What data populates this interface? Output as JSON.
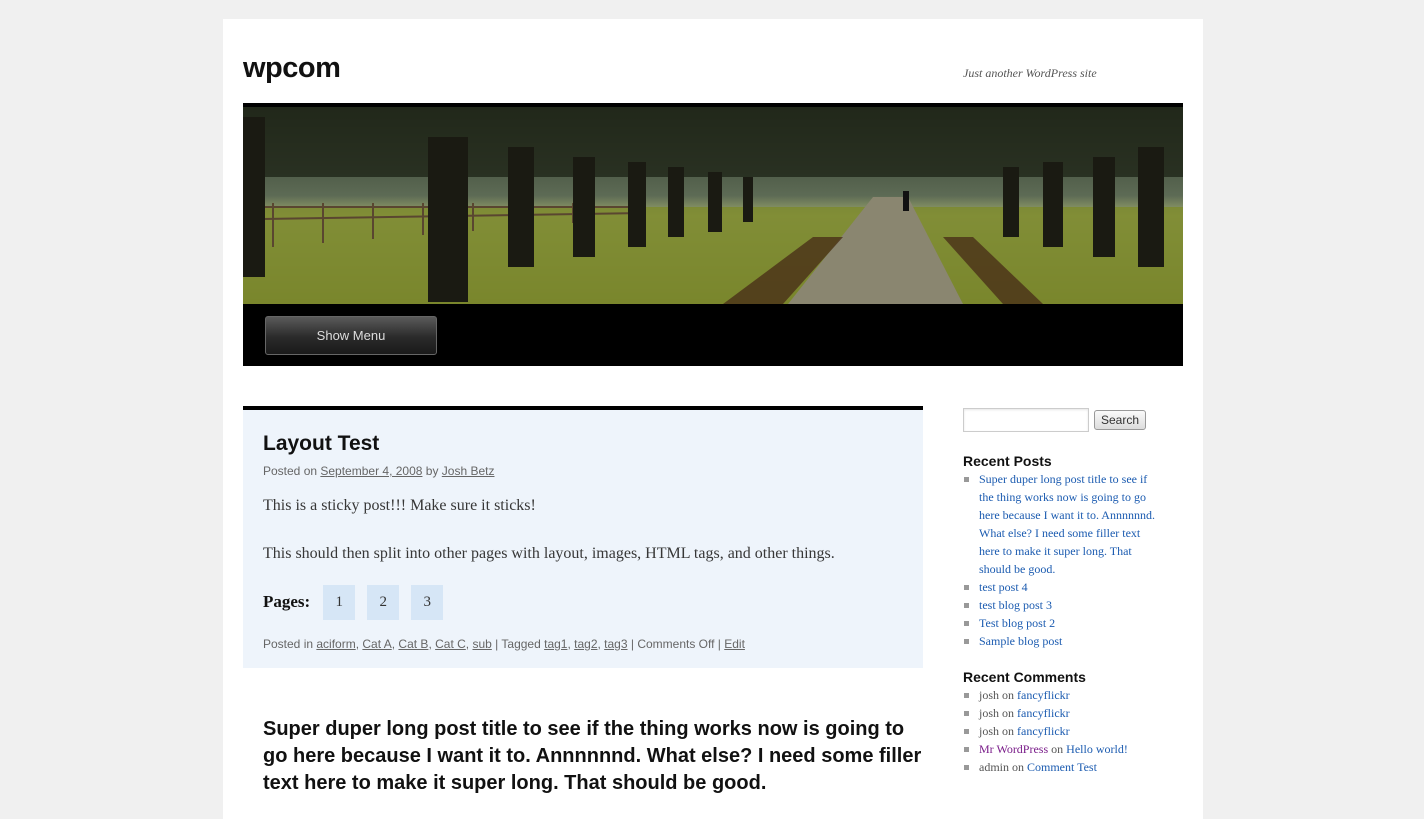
{
  "site": {
    "title": "wpcom",
    "description": "Just another WordPress site"
  },
  "menu": {
    "toggle_label": "Show Menu"
  },
  "sticky_post": {
    "title": "Layout Test",
    "meta_prefix": "Posted on ",
    "date": "September 4, 2008",
    "meta_by": " by ",
    "author": "Josh Betz",
    "paragraph1": "This is a sticky post!!! Make sure it sticks!",
    "paragraph2": "This should then split into other pages with layout, images, HTML tags, and other things.",
    "pages_label": "Pages:",
    "pages": [
      "1",
      "2",
      "3"
    ],
    "footer": {
      "posted_in": "Posted in ",
      "categories": [
        "aciform",
        "Cat A",
        "Cat B",
        "Cat C",
        "sub"
      ],
      "tagged": " | Tagged ",
      "tags": [
        "tag1",
        "tag2",
        "tag3"
      ],
      "comments": " | Comments Off | ",
      "edit": "Edit"
    }
  },
  "next_post": {
    "title": "Super duper long post title to see if the thing works now is going to go here because I want it to. Annnnnnd. What else? I need some filler text here to make it super long. That should be good."
  },
  "sidebar": {
    "search_button": "Search",
    "search_placeholder": "",
    "recent_posts_title": "Recent Posts",
    "recent_posts": [
      "Super duper long post title to see if the thing works now is going to go here because I want it to. Annnnnnd. What else? I need some filler text here to make it super long. That should be good.",
      "test post 4",
      "test blog post 3",
      "Test blog post 2",
      "Sample blog post"
    ],
    "recent_comments_title": "Recent Comments",
    "recent_comments": [
      {
        "author": "josh",
        "on": " on ",
        "post": "fancyflickr"
      },
      {
        "author": "josh",
        "on": " on ",
        "post": "fancyflickr"
      },
      {
        "author": "josh",
        "on": " on ",
        "post": "fancyflickr"
      },
      {
        "author": "Mr WordPress",
        "on": " on ",
        "post": "Hello world!"
      },
      {
        "author": "admin",
        "on": " on ",
        "post": "Comment Test"
      }
    ]
  },
  "colors": {
    "link": "#1b5bb0",
    "visited_link": "#7a1d8a",
    "sticky_bg": "#eef4fb",
    "page_num_bg": "#d6e6f6"
  }
}
